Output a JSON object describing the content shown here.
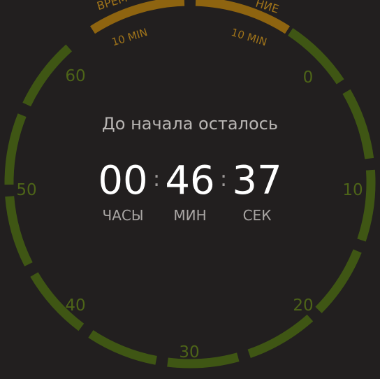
{
  "headline": "До начала осталось",
  "timer": {
    "hours": "00",
    "minutes": "46",
    "seconds": "37",
    "hours_label": "ЧАСЫ",
    "minutes_label": "МИН",
    "seconds_label": "СЕК",
    "separator": ":"
  },
  "dial": {
    "minute_labels": [
      "0",
      "10",
      "20",
      "30",
      "40",
      "50",
      "60"
    ],
    "left_window": {
      "label": "ВРЕМ",
      "duration": "10 MIN"
    },
    "right_window": {
      "label": "НИЕ",
      "duration": "10 MIN"
    }
  },
  "colors": {
    "background": "#221f1f",
    "ring_green": "#3f5614",
    "ring_gold": "#8e6410",
    "minute_label": "#4d6418",
    "window_label": "#a0741a"
  }
}
